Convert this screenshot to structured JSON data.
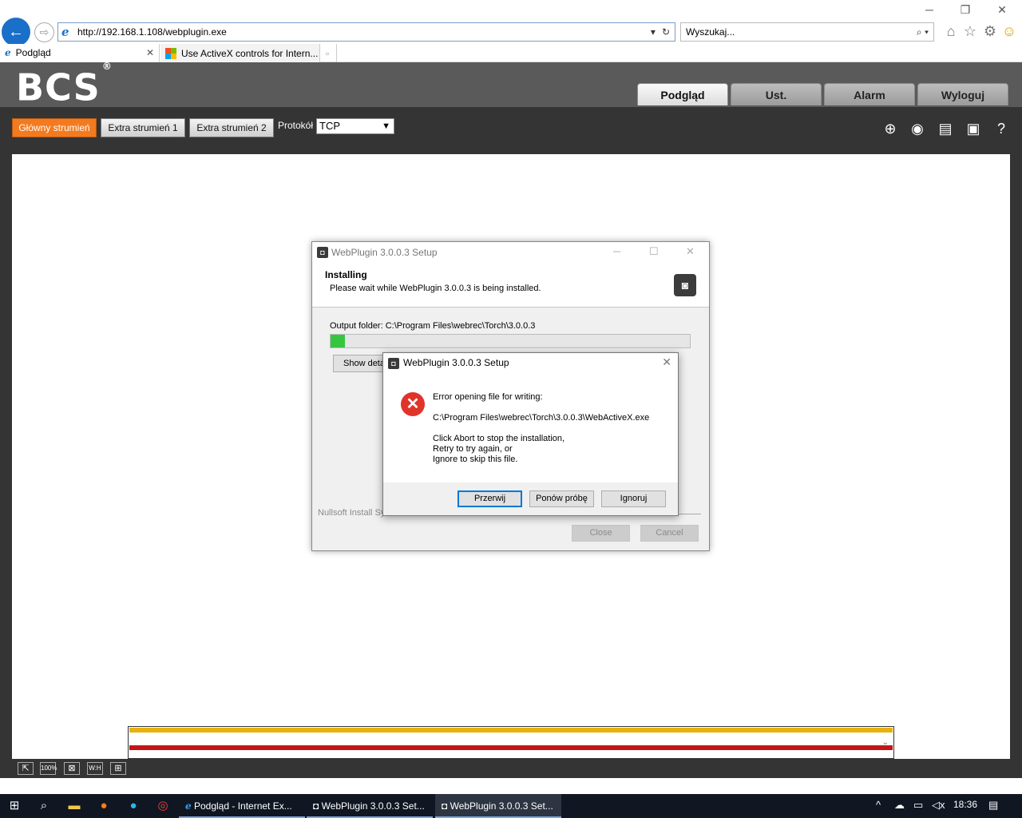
{
  "browser": {
    "address": "http://192.168.1.108/webplugin.exe",
    "search_placeholder": "Wyszukaj...",
    "tabs": [
      {
        "label": "Podgląd"
      },
      {
        "label": "Use ActiveX controls for Intern..."
      }
    ]
  },
  "nav_tabs": [
    "Podgląd",
    "Ust.",
    "Alarm",
    "Wyloguj"
  ],
  "logo": {
    "text": "BCS",
    "mark": "®"
  },
  "toolbar": {
    "streams": [
      "Główny strumień",
      "Extra strumień 1",
      "Extra strumień 2"
    ],
    "protocol_label": "Protokół",
    "protocol_value": "TCP"
  },
  "bottom_bar": {
    "zoom": "100%",
    "wh": "W:H"
  },
  "setup": {
    "title": "WebPlugin 3.0.0.3 Setup",
    "heading": "Installing",
    "subheading": "Please wait while WebPlugin 3.0.0.3 is being installed.",
    "output_folder": "Output folder: C:\\Program Files\\webrec\\Torch\\3.0.0.3",
    "progress": 0.04,
    "show_details": "Show details",
    "nullsoft": "Nullsoft Install System",
    "close": "Close",
    "cancel": "Cancel"
  },
  "error": {
    "title": "WebPlugin 3.0.0.3 Setup",
    "line1": "Error opening file for writing:",
    "line2": "C:\\Program Files\\webrec\\Torch\\3.0.0.3\\WebActiveX.exe",
    "line3": "Click Abort to stop the installation,",
    "line4": "Retry to try again, or",
    "line5": "Ignore to skip this file.",
    "buttons": [
      "Przerwij",
      "Ponów próbę",
      "Ignoruj"
    ]
  },
  "taskbar": {
    "apps": [
      "Podgląd - Internet Ex...",
      "WebPlugin 3.0.0.3 Set...",
      "WebPlugin 3.0.0.3 Set..."
    ],
    "time": "18:36"
  },
  "colors": {
    "orange": "#f47a1f",
    "ie_blue": "#1a6fc9",
    "progress": "#35c640",
    "error": "#e0332a"
  }
}
